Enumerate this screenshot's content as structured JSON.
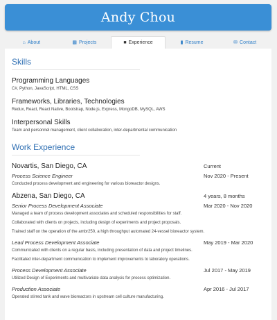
{
  "header": {
    "name": "Andy Chou"
  },
  "tabs": [
    {
      "label": "About",
      "icon": "home-icon"
    },
    {
      "label": "Projects",
      "icon": "folder-icon"
    },
    {
      "label": "Experience",
      "icon": "briefcase-icon"
    },
    {
      "label": "Resume",
      "icon": "file-icon"
    },
    {
      "label": "Contact",
      "icon": "envelope-icon"
    }
  ],
  "skills": {
    "title": "Skills",
    "groups": [
      {
        "heading": "Programming Languages",
        "items": "C#, Python, JavaScript, HTML, CSS"
      },
      {
        "heading": "Frameworks, Libraries, Technologies",
        "items": "Redux, React, React Native, Bootstrap, Node.js, Express, MongoDB, MySQL, AWS"
      },
      {
        "heading": "Interpersonal Skills",
        "items": "Team and personnel management, client collaboration, inter-departmental communication"
      }
    ]
  },
  "experience": {
    "title": "Work Experience",
    "jobs": [
      {
        "company": "Novartis, San Diego, CA",
        "tenure": "Current",
        "roles": [
          {
            "title": "Process Science Engineer",
            "dates": "Nov 2020 - Present",
            "bullets": [
              "Conducted process development and engineering for various bioreactor designs."
            ]
          }
        ]
      },
      {
        "company": "Abzena, San Diego, CA",
        "tenure": "4 years, 8 months",
        "roles": [
          {
            "title": "Senior Process Development Associate",
            "dates": "Mar 2020 - Nov 2020",
            "bullets": [
              "Managed a team of process development associates and scheduled responsibilities for staff.",
              "Collaborated with clients on projects, including design of experiments and project proposals.",
              "Trained staff on the operation of the ambr250, a high throughput automated 24-vessel bioreactor system."
            ]
          },
          {
            "title": "Lead Process Development Associate",
            "dates": "May 2019 - Mar 2020",
            "bullets": [
              "Communicated with clients on a regular basis, including presentation of data and project timelines.",
              "Facilitated inter-department communication to implement improvements to laboratory operations."
            ]
          },
          {
            "title": "Process Development Associate",
            "dates": "Jul 2017 - May 2019",
            "bullets": [
              "Utilized Design of Experiments and multivariate data analysis for process optimization."
            ]
          },
          {
            "title": "Production Associate",
            "dates": "Apr 2016 - Jul 2017",
            "bullets": [
              "Operated stirred tank and wave bioreactors in upstream cell culture manufacturing."
            ]
          }
        ]
      }
    ]
  }
}
